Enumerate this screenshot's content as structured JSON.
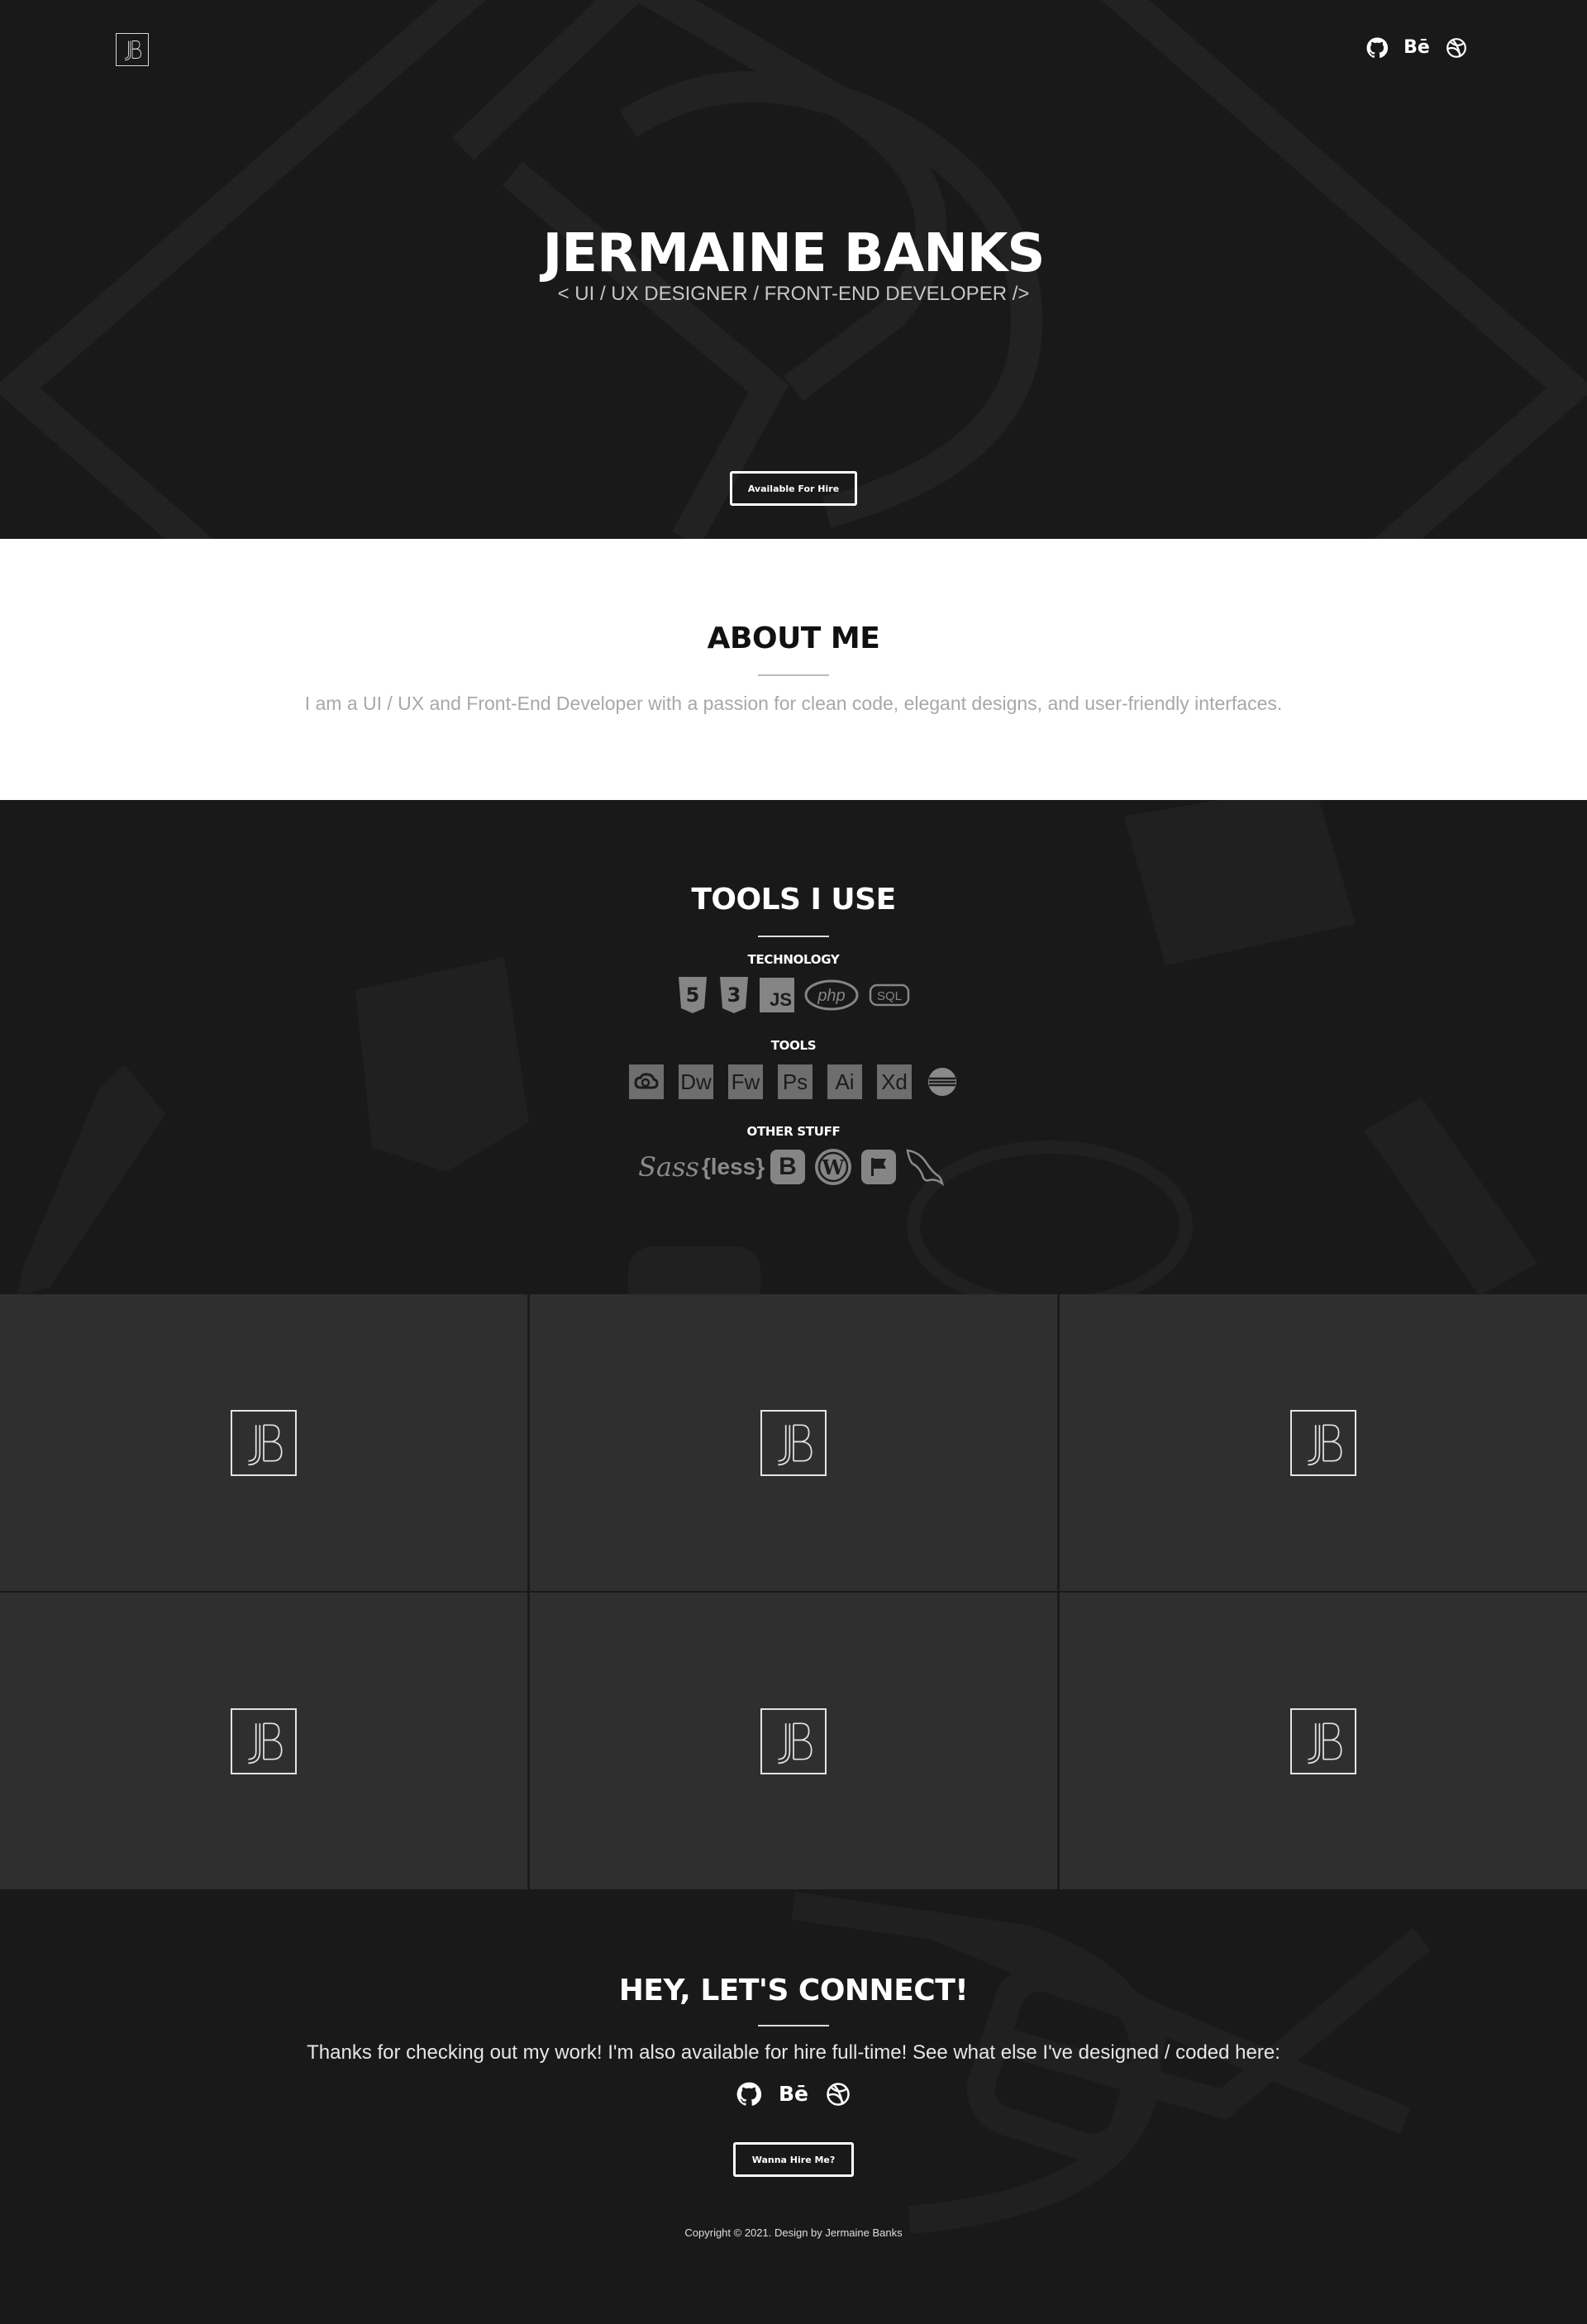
{
  "header": {
    "logo_alt": "JB",
    "social": [
      {
        "icon": "github-icon"
      },
      {
        "icon": "behance-icon",
        "label": "Bē"
      },
      {
        "icon": "dribbble-icon"
      }
    ]
  },
  "hero": {
    "name": "JERMAINE BANKS",
    "subtitle": "< UI / UX DESIGNER / FRONT-END DEVELOPER />",
    "cta": "Available For Hire"
  },
  "about": {
    "title": "ABOUT ME",
    "text": "I am a UI / UX and Front-End Developer with a passion for clean code, elegant designs, and user-friendly interfaces."
  },
  "tools": {
    "title": "TOOLS I USE",
    "categories": [
      {
        "label": "TECHNOLOGY",
        "icons": [
          "html5-icon",
          "css3-icon",
          "javascript-icon",
          "php-icon",
          "sql-icon"
        ],
        "texts": {
          "js": "JS",
          "php": "php",
          "sql": "SQL"
        }
      },
      {
        "label": "TOOLS",
        "icons": [
          "creative-cloud-icon",
          "dreamweaver-icon",
          "fireworks-icon",
          "photoshop-icon",
          "illustrator-icon",
          "xd-icon",
          "eclipse-icon"
        ],
        "texts": {
          "dw": "Dw",
          "fw": "Fw",
          "ps": "Ps",
          "ai": "Ai",
          "xd": "Xd"
        }
      },
      {
        "label": "OTHER STUFF",
        "icons": [
          "sass-icon",
          "less-icon",
          "bootstrap-icon",
          "wordpress-icon",
          "flag-icon",
          "mysql-icon"
        ],
        "texts": {
          "sass": "Sass",
          "less": "{less}",
          "bootstrap": "B"
        }
      }
    ]
  },
  "portfolio": {
    "items": [
      {
        "logo": "JB"
      },
      {
        "logo": "JB"
      },
      {
        "logo": "JB"
      },
      {
        "logo": "JB"
      },
      {
        "logo": "JB"
      },
      {
        "logo": "JB"
      }
    ]
  },
  "connect": {
    "title": "HEY, LET'S CONNECT!",
    "text": "Thanks for checking out my work! I'm also available for hire full-time! See what else I've designed / coded here:",
    "cta": "Wanna Hire Me?",
    "copyright": "Copyright © 2021. Design by Jermaine Banks"
  },
  "colors": {
    "dark_bg": "#191919",
    "card_bg": "#2f2f2f",
    "white": "#ffffff",
    "muted_text": "#a8a8a8"
  }
}
